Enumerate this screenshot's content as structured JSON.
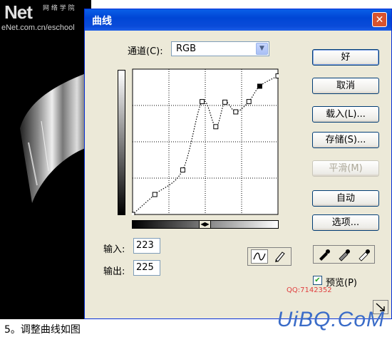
{
  "background": {
    "logo": "Net",
    "logo_sub": "网 络 学 院",
    "site_url": "eNet.com.cn/eschool",
    "caption": "5。调整曲线如图",
    "brand": "UiBQ.CoM",
    "qq": "QQ:7142352"
  },
  "dialog": {
    "title": "曲线",
    "close_icon": "close-icon",
    "channel_label": "通道(C):",
    "channel_value": "RGB",
    "input_label": "输入:",
    "input_value": "223",
    "output_label": "输出:",
    "output_value": "225",
    "buttons": {
      "ok": "好",
      "cancel": "取消",
      "load": "载入(L)...",
      "save": "存储(S)...",
      "smooth": "平滑(M)",
      "auto": "自动",
      "options": "选项..."
    },
    "preview_label": "预览(P)",
    "preview_checked": true
  },
  "chart_data": {
    "type": "line",
    "title": "",
    "xlabel": "",
    "ylabel": "",
    "xlim": [
      0,
      255
    ],
    "ylim": [
      0,
      255
    ],
    "grid": true,
    "points": [
      {
        "x": 0,
        "y": 0
      },
      {
        "x": 39,
        "y": 35
      },
      {
        "x": 88,
        "y": 78
      },
      {
        "x": 122,
        "y": 198
      },
      {
        "x": 146,
        "y": 154
      },
      {
        "x": 162,
        "y": 197
      },
      {
        "x": 181,
        "y": 180
      },
      {
        "x": 204,
        "y": 198
      },
      {
        "x": 223,
        "y": 225
      },
      {
        "x": 255,
        "y": 243
      }
    ]
  }
}
